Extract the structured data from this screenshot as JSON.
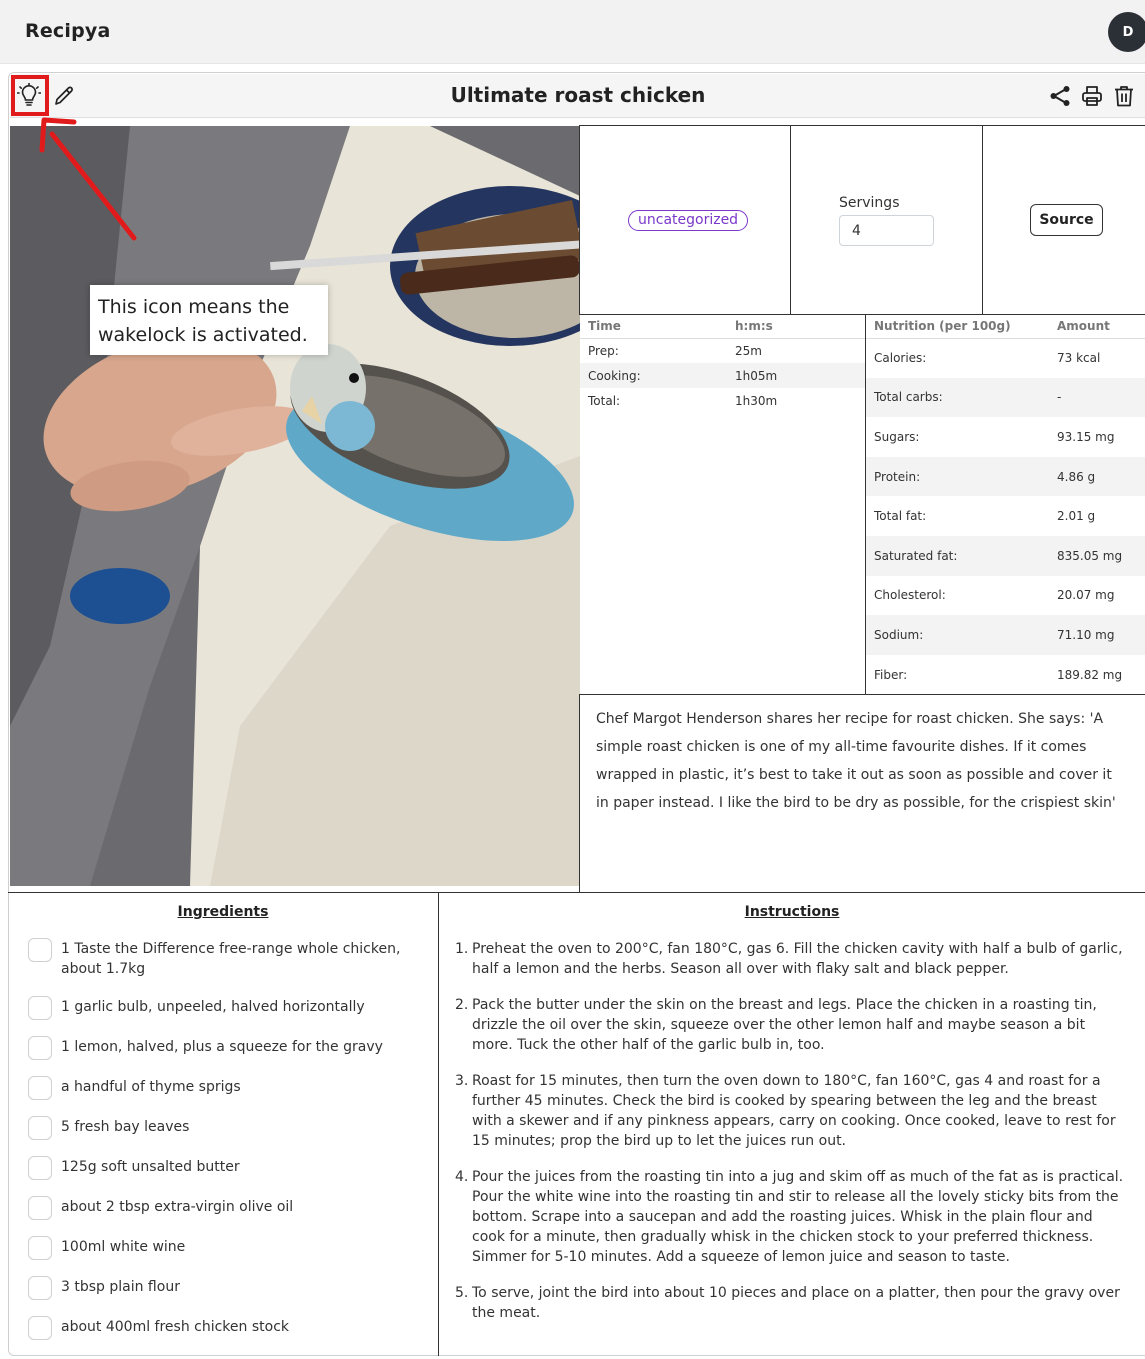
{
  "app": {
    "brand": "Recipya",
    "avatar_initial": "D"
  },
  "recipe": {
    "title": "Ultimate roast chicken",
    "category": "uncategorized",
    "servings_label": "Servings",
    "servings_value": "4",
    "source_label": "Source",
    "description": "Chef Margot Henderson shares her recipe for roast chicken. She says: 'A simple roast chicken is one of my all-time favourite dishes. If it comes wrapped in plastic, it’s best to take it out as soon as possible and cover it in paper instead. I like the bird to be dry as possible, for the crispiest skin'"
  },
  "annotation": {
    "text": "This icon means the wakelock is activated.",
    "highlight_color": "#e11b1b"
  },
  "icons": [
    "lightbulb-icon",
    "pencil-icon",
    "share-icon",
    "printer-icon",
    "trash-icon"
  ],
  "time_table": {
    "headers": [
      "Time",
      "h:m:s"
    ],
    "rows": [
      {
        "label": "Prep:",
        "value": "25m"
      },
      {
        "label": "Cooking:",
        "value": "1h05m"
      },
      {
        "label": "Total:",
        "value": "1h30m"
      }
    ]
  },
  "nutrition_table": {
    "headers": [
      "Nutrition (per 100g)",
      "Amount"
    ],
    "rows": [
      {
        "label": "Calories:",
        "value": "73 kcal"
      },
      {
        "label": "Total carbs:",
        "value": "-"
      },
      {
        "label": "Sugars:",
        "value": "93.15 mg"
      },
      {
        "label": "Protein:",
        "value": "4.86 g"
      },
      {
        "label": "Total fat:",
        "value": "2.01 g"
      },
      {
        "label": "Saturated fat:",
        "value": "835.05 mg"
      },
      {
        "label": "Cholesterol:",
        "value": "20.07 mg"
      },
      {
        "label": "Sodium:",
        "value": "71.10 mg"
      },
      {
        "label": "Fiber:",
        "value": "189.82 mg"
      }
    ]
  },
  "ingredients": {
    "heading": "Ingredients",
    "items": [
      "1 Taste the Difference free-range whole chicken, about 1.7kg",
      "1 garlic bulb, unpeeled, halved horizontally",
      "1 lemon, halved, plus a squeeze for the gravy",
      "a handful of thyme sprigs",
      "5 fresh bay leaves",
      "125g soft unsalted butter",
      "about 2 tbsp extra-virgin olive oil",
      "100ml white wine",
      "3 tbsp plain flour",
      "about 400ml fresh chicken stock"
    ]
  },
  "instructions": {
    "heading": "Instructions",
    "steps": [
      {
        "num": "1.",
        "text": "Preheat the oven to 200°C, fan 180°C, gas 6. Fill the chicken cavity with half a bulb of garlic, half a lemon and the herbs. Season all over with flaky salt and black pepper."
      },
      {
        "num": "2.",
        "text": "Pack the butter under the skin on the breast and legs. Place the chicken in a roasting tin, drizzle the oil over the skin, squeeze over the other lemon half and maybe season a bit more. Tuck the other half of the garlic bulb in, too."
      },
      {
        "num": "3.",
        "text": "Roast for 15 minutes, then turn the oven down to 180°C, fan 160°C, gas 4 and roast for a further 45 minutes. Check the bird is cooked by spearing between the leg and the breast with a skewer and if any pinkness appears, carry on cooking. Once cooked, leave to rest for 15 minutes; prop the bird up to let the juices run out."
      },
      {
        "num": "4.",
        "text": "Pour the juices from the roasting tin into a jug and skim off as much of the fat as is practical. Pour the white wine into the roasting tin and stir to release all the lovely sticky bits from the bottom. Scrape into a saucepan and add the roasting juices. Whisk in the plain flour and cook for a minute, then gradually whisk in the chicken stock to your preferred thickness. Simmer for 5-10 minutes. Add a squeeze of lemon juice and season to taste."
      },
      {
        "num": "5.",
        "text": "To serve, joint the bird into about 10 pieces and place on a platter, then pour the gravy over the meat."
      }
    ]
  }
}
